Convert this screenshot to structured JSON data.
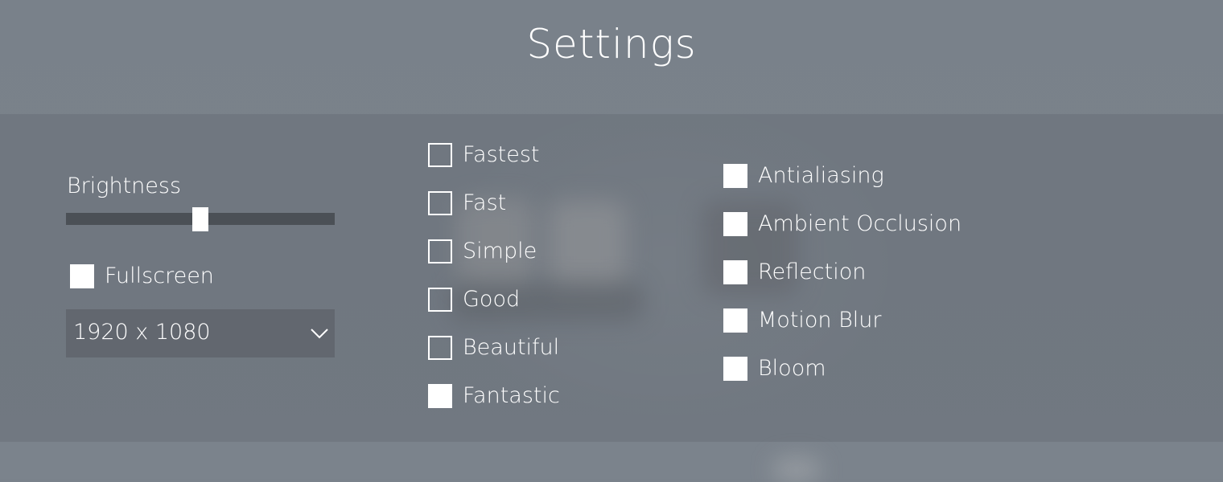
{
  "title": "Settings",
  "brightness": {
    "label": "Brightness",
    "value": 0.5
  },
  "fullscreen": {
    "label": "Fullscreen",
    "checked": true
  },
  "resolution": {
    "selected": "1920 x 1080"
  },
  "quality_levels": [
    {
      "label": "Fastest",
      "checked": false
    },
    {
      "label": "Fast",
      "checked": false
    },
    {
      "label": "Simple",
      "checked": false
    },
    {
      "label": "Good",
      "checked": false
    },
    {
      "label": "Beautiful",
      "checked": false
    },
    {
      "label": "Fantastic",
      "checked": true
    }
  ],
  "effects": [
    {
      "label": "Antialiasing",
      "checked": true
    },
    {
      "label": "Ambient Occlusion",
      "checked": true
    },
    {
      "label": "Reflection",
      "checked": true
    },
    {
      "label": "Motion Blur",
      "checked": true
    },
    {
      "label": "Bloom",
      "checked": true
    }
  ],
  "icons": {
    "dropdown_arrow": "chevron-down-icon"
  }
}
